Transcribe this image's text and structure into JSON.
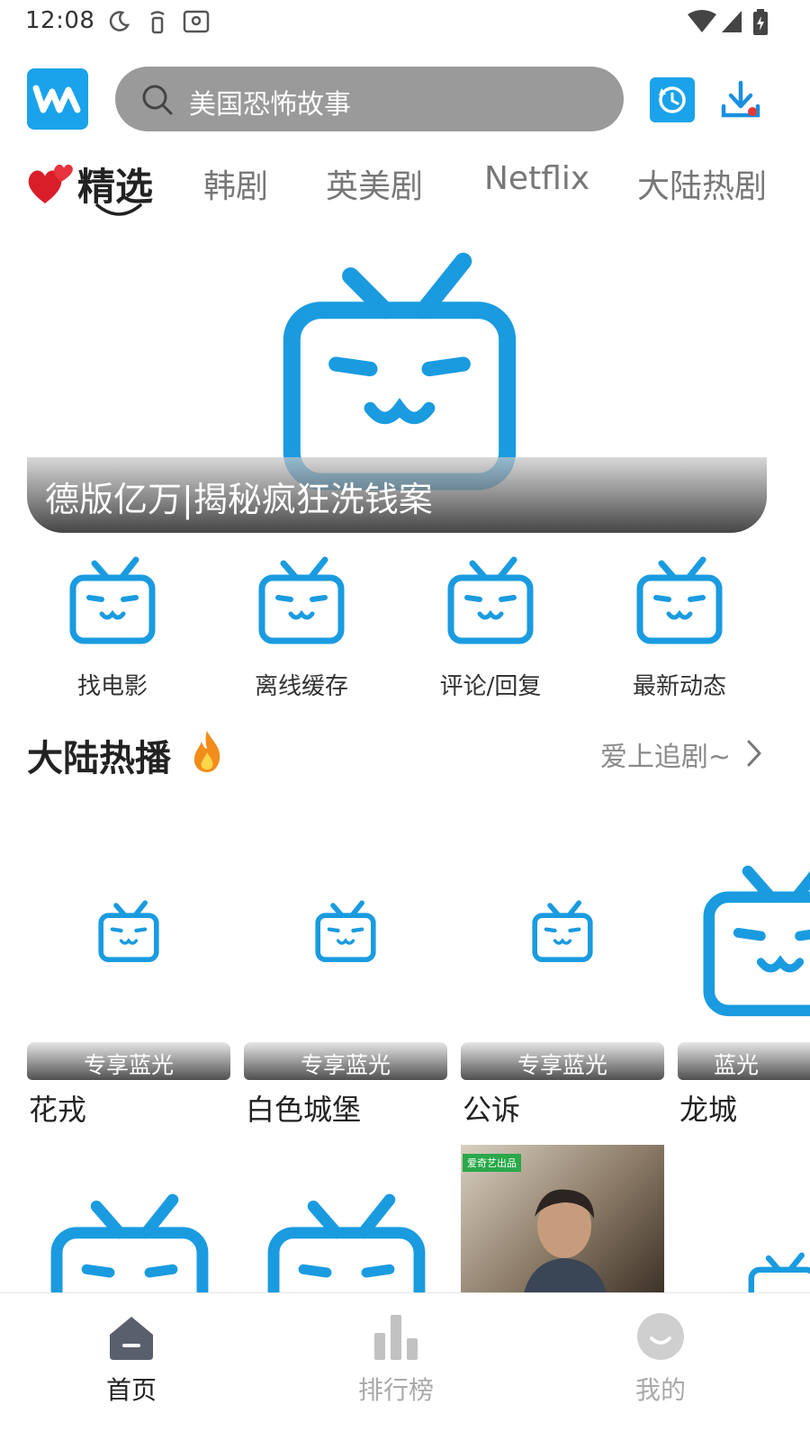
{
  "status_bar": {
    "time": "12:08"
  },
  "header": {
    "search_placeholder": "美国恐怖故事",
    "accent": "#1aa3ea"
  },
  "tabs": [
    {
      "label": "精选",
      "active": true
    },
    {
      "label": "韩剧"
    },
    {
      "label": "英美剧"
    },
    {
      "label": "Netflix"
    },
    {
      "label": "大陆热剧"
    }
  ],
  "banner": {
    "title": "德版亿万|揭秘疯狂洗钱案"
  },
  "quick_entries": [
    {
      "label": "找电影",
      "icon": "tv-mascot-icon"
    },
    {
      "label": "离线缓存",
      "icon": "tv-mascot-icon"
    },
    {
      "label": "评论/回复",
      "icon": "tv-mascot-icon"
    },
    {
      "label": "最新动态",
      "icon": "tv-mascot-icon"
    }
  ],
  "section": {
    "title": "大陆热播",
    "more_label": "爱上追剧~"
  },
  "cards": [
    {
      "title": "花戎",
      "badge": "专享蓝光"
    },
    {
      "title": "白色城堡",
      "badge": "专享蓝光"
    },
    {
      "title": "公诉",
      "badge": "专享蓝光"
    },
    {
      "title": "龙城",
      "badge": "蓝光"
    }
  ],
  "poster": {
    "tag": "爱奇艺出品"
  },
  "bottom_nav": [
    {
      "label": "首页",
      "active": true,
      "icon": "home-icon"
    },
    {
      "label": "排行榜",
      "icon": "chart-icon"
    },
    {
      "label": "我的",
      "icon": "profile-icon"
    }
  ],
  "colors": {
    "active_nav": "#222222",
    "inactive_nav": "#aaaaaa",
    "mascot_blue": "#1a9be0"
  }
}
